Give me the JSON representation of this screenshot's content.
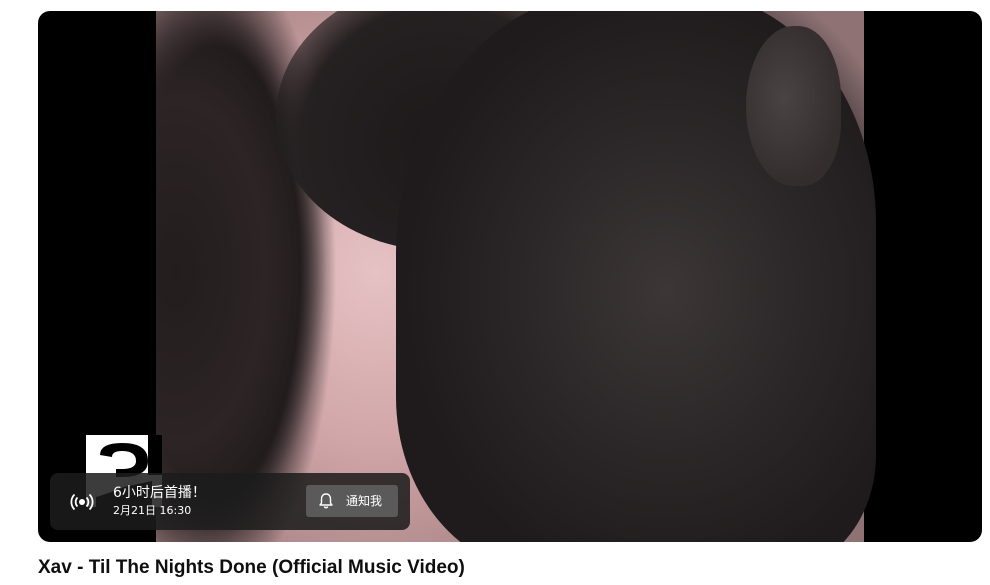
{
  "player": {
    "channel_logo_icon": "channel-logo-icon",
    "premiere": {
      "icon": "live-broadcast-icon",
      "title": "6小时后首播！",
      "time": "2月21日 16:30",
      "notify_icon": "bell-icon",
      "notify_label": "通知我"
    }
  },
  "video": {
    "title": "Xav - Til The Nights Done (Official Music Video)"
  }
}
